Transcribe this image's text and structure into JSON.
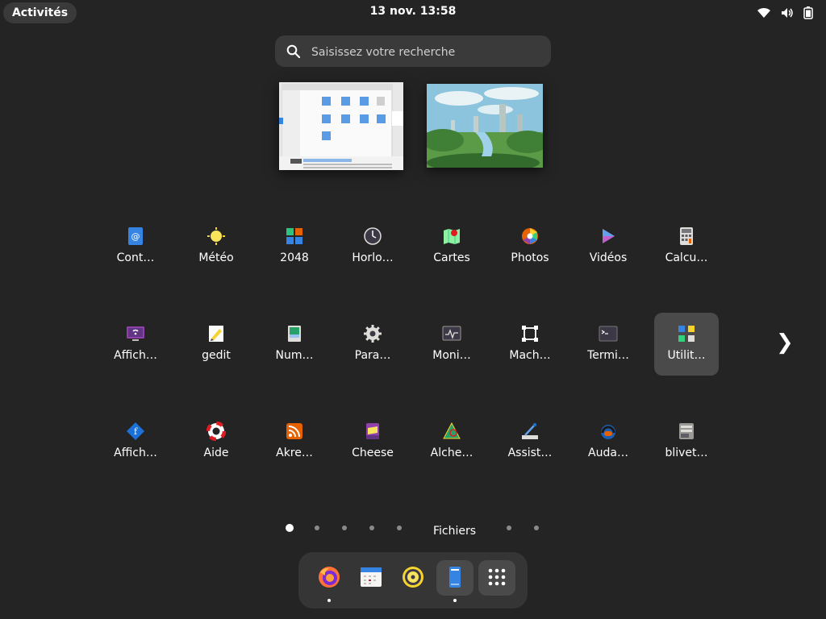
{
  "topbar": {
    "activities_label": "Activités",
    "clock": "13 nov.  13:58"
  },
  "search": {
    "placeholder": "Saisissez votre recherche"
  },
  "apps": [
    {
      "label": "Cont…",
      "icon": "contacts-icon"
    },
    {
      "label": "Météo",
      "icon": "weather-icon"
    },
    {
      "label": "2048",
      "icon": "game-2048-icon"
    },
    {
      "label": "Horlo…",
      "icon": "clock-icon"
    },
    {
      "label": "Cartes",
      "icon": "maps-icon"
    },
    {
      "label": "Photos",
      "icon": "photos-icon"
    },
    {
      "label": "Vidéos",
      "icon": "videos-icon"
    },
    {
      "label": "Calcu…",
      "icon": "calculator-icon"
    },
    {
      "label": "Affich…",
      "icon": "remote-desktop-icon"
    },
    {
      "label": "gedit",
      "icon": "text-editor-icon"
    },
    {
      "label": "Num…",
      "icon": "scanner-icon"
    },
    {
      "label": "Para…",
      "icon": "settings-gear-icon"
    },
    {
      "label": "Moni…",
      "icon": "system-monitor-icon"
    },
    {
      "label": "Mach…",
      "icon": "virtual-machines-icon"
    },
    {
      "label": "Termi…",
      "icon": "terminal-icon"
    },
    {
      "label": "Utilit…",
      "icon": "utilities-folder-icon",
      "selected": true
    },
    {
      "label": "Affich…",
      "icon": "font-viewer-icon"
    },
    {
      "label": "Aide",
      "icon": "help-lifebuoy-icon"
    },
    {
      "label": "Akre…",
      "icon": "feed-reader-icon"
    },
    {
      "label": "Cheese",
      "icon": "cheese-webcam-icon"
    },
    {
      "label": "Alche…",
      "icon": "alchemy-icon"
    },
    {
      "label": "Assist…",
      "icon": "assistant-icon"
    },
    {
      "label": "Auda…",
      "icon": "audacity-icon"
    },
    {
      "label": "blivet…",
      "icon": "blivet-disk-icon"
    }
  ],
  "pager": {
    "label": "Fichiers"
  },
  "dock": [
    {
      "name": "firefox",
      "icon": "firefox-icon",
      "running": true
    },
    {
      "name": "calendar",
      "icon": "calendar-icon",
      "running": false
    },
    {
      "name": "rhythmbox",
      "icon": "music-player-icon",
      "running": false
    },
    {
      "name": "files",
      "icon": "files-icon",
      "running": true,
      "selected": true
    },
    {
      "name": "show-apps",
      "icon": "show-apps-grid-icon",
      "running": false,
      "selected": true
    }
  ],
  "colors": {
    "background": "#242424",
    "panel": "#3a3a3a",
    "selected": "#4a4a4a"
  }
}
